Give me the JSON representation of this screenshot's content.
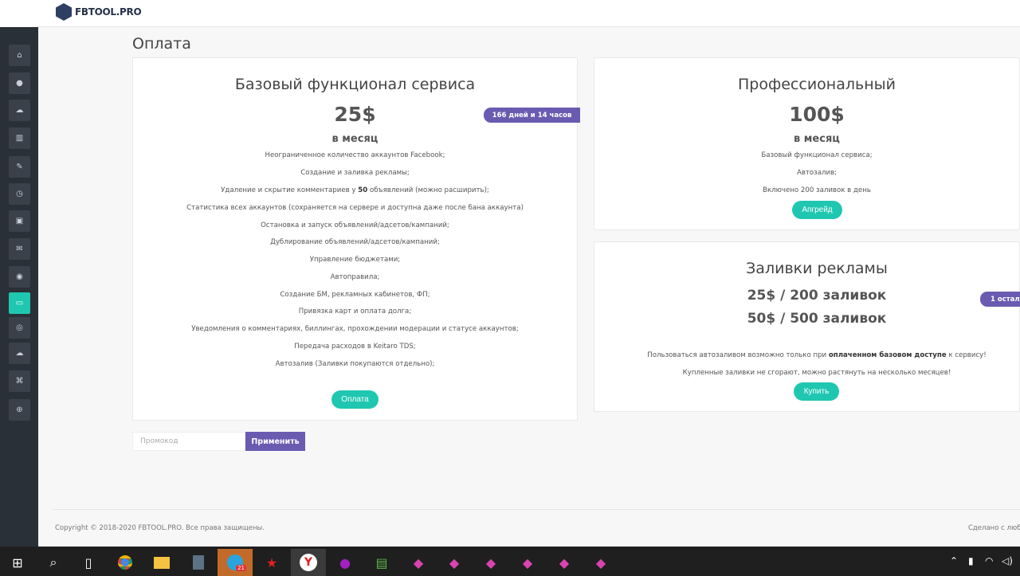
{
  "brand": {
    "name": "FBTOOL.PRO"
  },
  "page": {
    "title": "Оплата"
  },
  "basic": {
    "title": "Базовый функционал сервиса",
    "price": "25$",
    "period": "в месяц",
    "badge": "166 дней и 14 часов",
    "features": [
      "Неограниченное количество аккаунтов Facebook;",
      "Создание и заливка рекламы;",
      "Статистика всех аккаунтов (сохраняется на сервере и доступна даже после бана аккаунта)",
      "Остановка и запуск объявлений/адсетов/кампаний;",
      "Дублирование объявлений/адсетов/кампаний;",
      "Управление бюджетами;",
      "Автоправила;",
      "Создание БМ, рекламных кабинетов, ФП;",
      "Привязка карт и оплата долга;",
      "Уведомления о комментариях, биллингах, прохождении модерации и статусе аккаунтов;",
      "Передача расходов в Keitaro TDS;",
      "Автозалив (Заливки покупаются отдельно);"
    ],
    "comments_line": {
      "before": "Удаление и скрытие комментариев у ",
      "bold": "50",
      "after": " объявлений (можно расширить);"
    },
    "button": "Оплата"
  },
  "pro": {
    "title": "Профессиональный",
    "price": "100$",
    "period": "в месяц",
    "features": [
      "Базовый функционал сервиса;",
      "Автозалив;",
      "Включено 200 заливок в день"
    ],
    "button": "Апгрейд"
  },
  "uploads": {
    "title": "Заливки рекламы",
    "price1": "25$ / 200 заливок",
    "price2": "50$ / 500 заливок",
    "badge": "1 остал",
    "note1": {
      "before": "Пользоваться автозаливом возможно только при ",
      "bold": "оплаченном базовом доступе",
      "after": " к сервису!"
    },
    "note2": "Купленные заливки не сгорают, можно растянуть на несколько месяцев!",
    "button": "Купить"
  },
  "promo": {
    "placeholder": "Промокод",
    "button": "Применить"
  },
  "footer": {
    "copyright": "Copyright © 2018-2020 FBTOOL.PRO. Все права защищены.",
    "right": "Сделано с любо"
  },
  "taskbar": {
    "telegram_badge": "21"
  },
  "colors": {
    "accent": "#1fc7b1",
    "purple": "#6a5bb1",
    "sidebar": "#2a3038"
  }
}
